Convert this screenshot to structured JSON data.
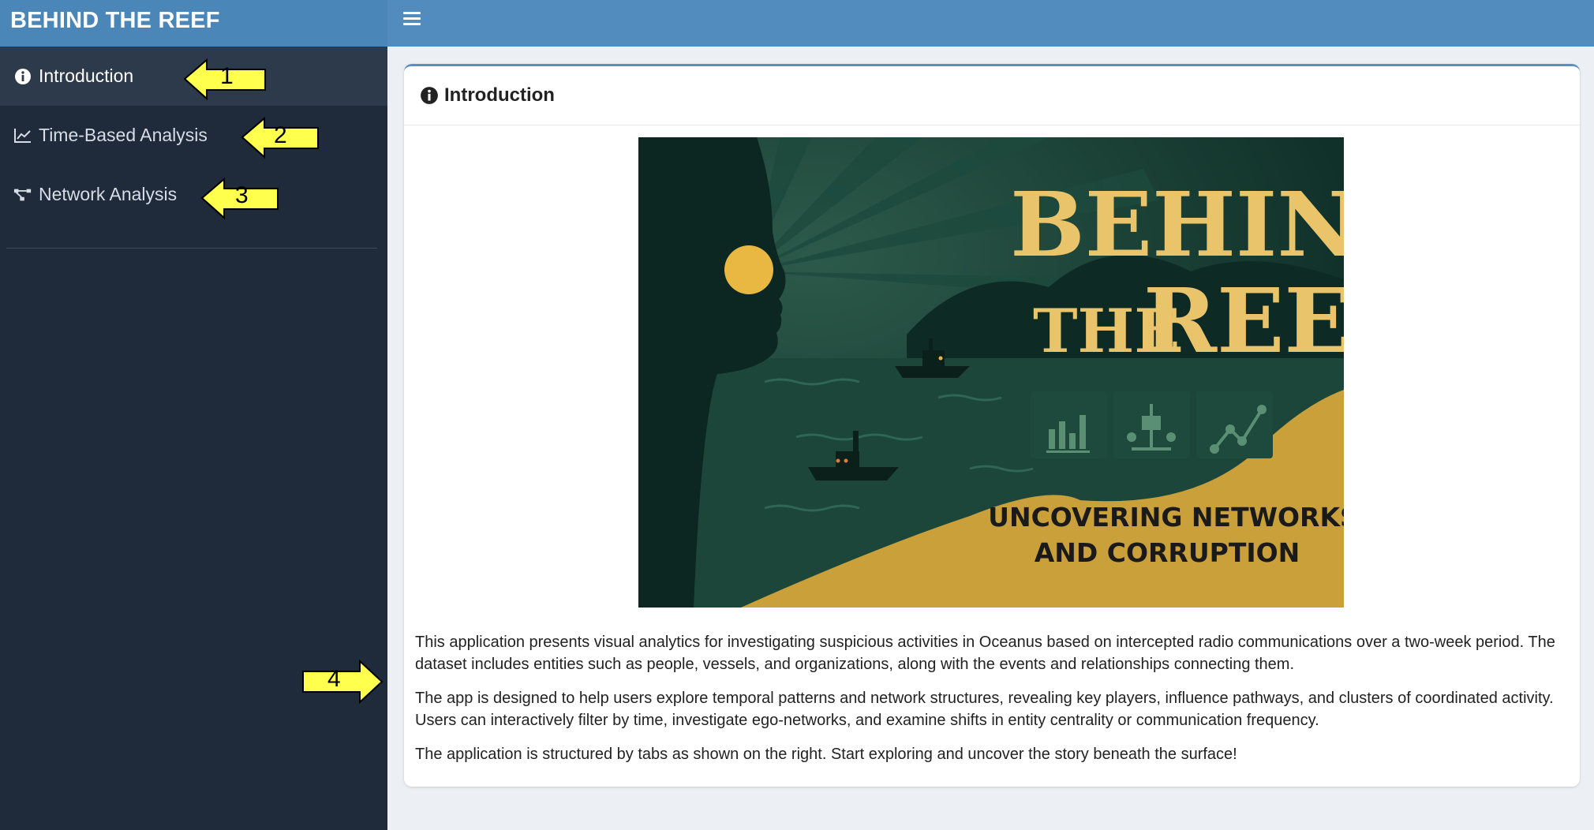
{
  "app": {
    "title": "BEHIND THE REEF"
  },
  "sidebar": {
    "items": [
      {
        "label": "Introduction",
        "icon": "info-circle-icon",
        "active": true
      },
      {
        "label": "Time-Based Analysis",
        "icon": "line-chart-icon",
        "active": false
      },
      {
        "label": "Network Analysis",
        "icon": "network-icon",
        "active": false
      }
    ]
  },
  "annotations": [
    "1",
    "2",
    "3",
    "4"
  ],
  "main": {
    "box_title": "Introduction",
    "poster": {
      "title_line1": "BEHIND",
      "title_line2a": "THE",
      "title_line2b": "REEF",
      "subtitle_line1": "UNCOVERING NETWORKS",
      "subtitle_line2": "AND CORRUPTION"
    },
    "paragraphs": [
      "This application presents visual analytics for investigating suspicious activities in Oceanus based on intercepted radio communications over a two-week period. The dataset includes entities such as people, vessels, and organizations, along with the events and relationships connecting them.",
      "The app is designed to help users explore temporal patterns and network structures, revealing key players, influence pathways, and clusters of coordinated activity. Users can interactively filter by time, investigate ego-networks, and examine shifts in entity centrality or communication frequency.",
      "The application is structured by tabs as shown on the right. Start exploring and uncover the story beneath the surface!"
    ]
  },
  "colors": {
    "header": "#528bbd",
    "sidebar": "#1f2a3a",
    "poster_bg": "#12352d",
    "poster_gold": "#e9c46a",
    "arrow_yellow": "#ffff4d"
  }
}
